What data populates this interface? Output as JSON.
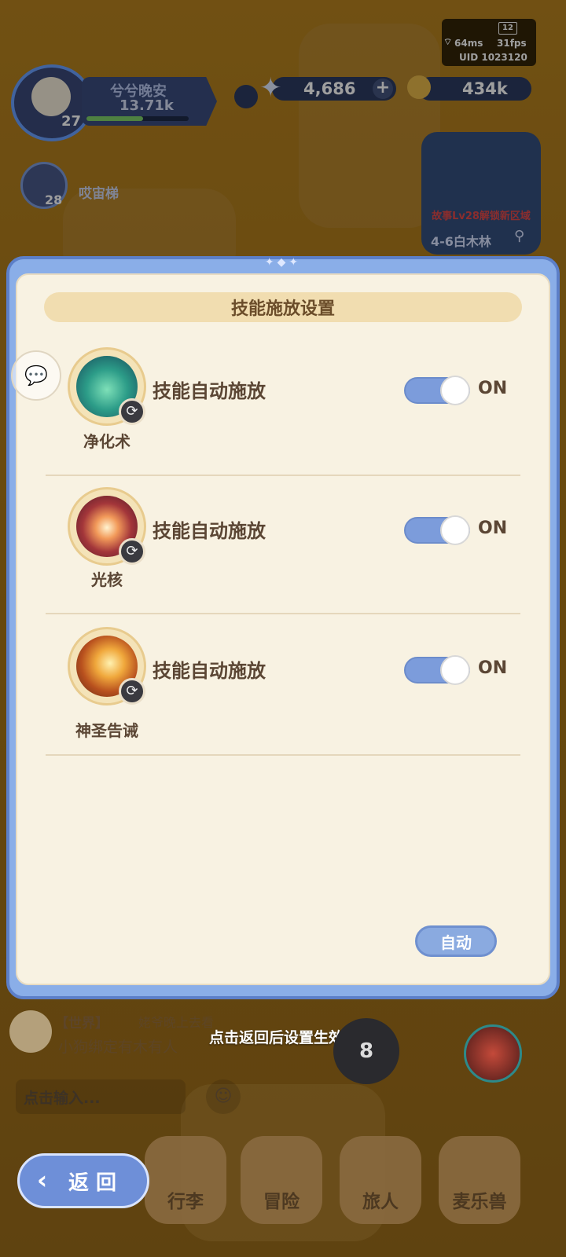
{
  "hud": {
    "ping": "64ms",
    "fps": "31fps",
    "uid": "UID 1023120",
    "sim_number": "12",
    "player": {
      "name": "兮兮晚安",
      "power": "13.71k",
      "level": "27",
      "exp_progress": 0.55
    },
    "gems": "4,686",
    "gold": "434k",
    "companion": {
      "name": "哎宙梯",
      "level": "28"
    },
    "map": {
      "unlock_text": "故事Lv28解锁新区域",
      "area_label": "4-6白木林"
    }
  },
  "modal": {
    "title": "技能施放设置",
    "skills": [
      {
        "name": "净化术",
        "auto_label": "技能自动施放",
        "state_label": "ON",
        "enabled": true,
        "icon": "purify-skill-icon"
      },
      {
        "name": "光核",
        "auto_label": "技能自动施放",
        "state_label": "ON",
        "enabled": true,
        "icon": "light-core-skill-icon"
      },
      {
        "name": "神圣告诫",
        "auto_label": "技能自动施放",
        "state_label": "ON",
        "enabled": true,
        "icon": "holy-warning-skill-icon"
      }
    ],
    "auto_button": "自动"
  },
  "chat": {
    "channel": "【世界】",
    "sender": "姥爷晚上去看",
    "message": "小狗绑定有木有人",
    "hint": "点击返回后设置生效",
    "input_placeholder": "点击输入..."
  },
  "bottom_nav": {
    "tabs": [
      "行李",
      "冒险",
      "旅人",
      "麦乐兽"
    ],
    "back_label": "返 回",
    "skill_slot_number": "8"
  },
  "colors": {
    "accent": "#7c9cdb",
    "panel": "#f8f2e2",
    "text": "#5b4634"
  }
}
